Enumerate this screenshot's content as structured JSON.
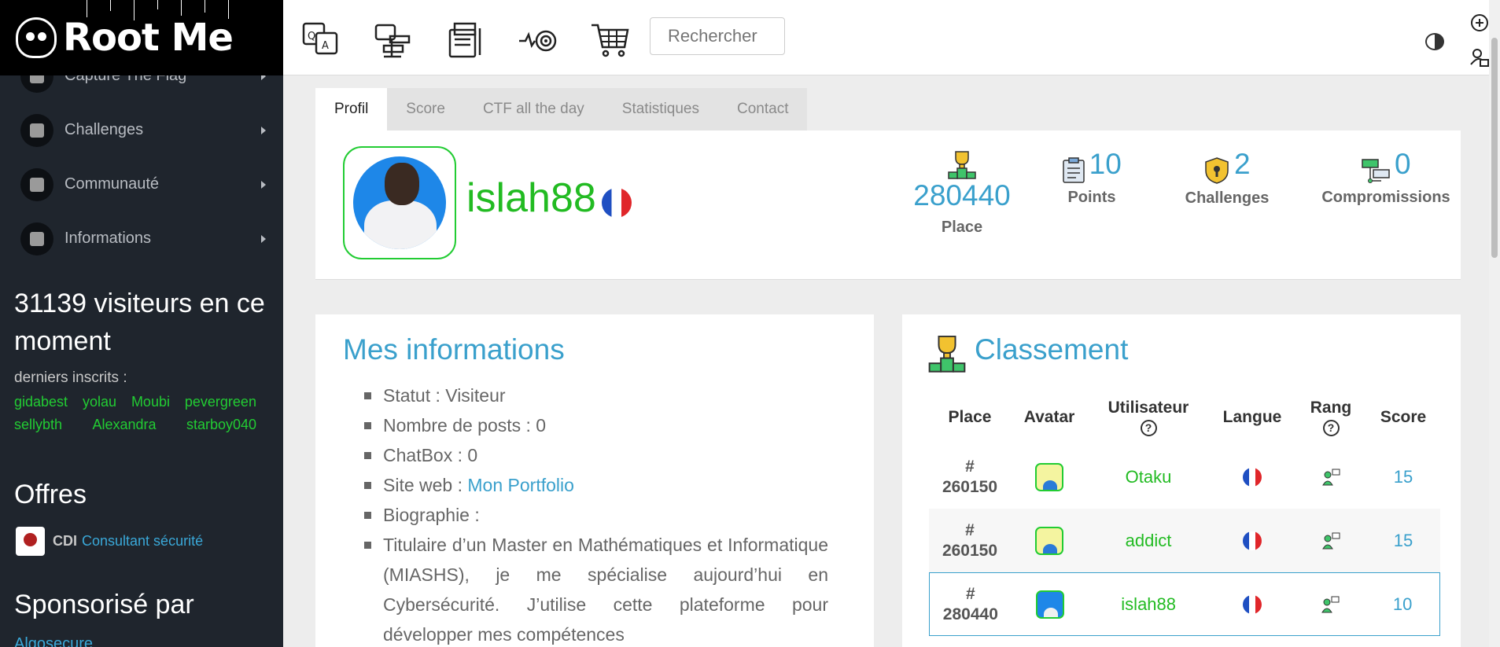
{
  "logo": {
    "text": "Root Me"
  },
  "sidebar": {
    "items": [
      {
        "label": "Capture The Flag"
      },
      {
        "label": "Challenges"
      },
      {
        "label": "Communauté"
      },
      {
        "label": "Informations"
      }
    ],
    "visitors": "31139 visiteurs en ce moment",
    "last_title": "derniers inscrits :",
    "last_users": [
      "gidabest",
      "yolau",
      "Moubi",
      "pevergreen",
      "sellybth",
      "Alexandra",
      "starboy040"
    ],
    "offres_title": "Offres",
    "offre": {
      "type": "CDI",
      "label": "Consultant sécurité"
    },
    "sponso_title": "Sponsorisé par",
    "sponso_link": "Algosecure"
  },
  "topbar": {
    "search_placeholder": "Rechercher"
  },
  "tabs": [
    "Profil",
    "Score",
    "CTF all the day",
    "Statistiques",
    "Contact"
  ],
  "profile": {
    "username": "islah88",
    "place": {
      "value": "280440",
      "label": "Place"
    },
    "points": {
      "value": "10",
      "label": "Points"
    },
    "challenges": {
      "value": "2",
      "label": "Challenges"
    },
    "compromissions": {
      "value": "0",
      "label": "Compromissions"
    }
  },
  "info": {
    "title": "Mes informations",
    "statut": "Statut : Visiteur",
    "posts": "Nombre de posts : 0",
    "chatbox": "ChatBox : 0",
    "site_prefix": "Site web : ",
    "site_link": "Mon Portfolio",
    "bio_label": "Biographie :",
    "bio_text": "Titulaire d’un Master en Mathématiques et Informatique (MIASHS), je me spécialise aujourd’hui en Cybersécurité. J’utilise cette plateforme pour développer mes compétences"
  },
  "ranking": {
    "title": "Classement",
    "headers": {
      "place": "Place",
      "avatar": "Avatar",
      "user": "Utilisateur",
      "lang": "Langue",
      "rang": "Rang",
      "score": "Score"
    },
    "rows": [
      {
        "hash": "#",
        "place": "260150",
        "user": "Otaku",
        "score": "15"
      },
      {
        "hash": "#",
        "place": "260150",
        "user": "addict",
        "score": "15"
      },
      {
        "hash": "#",
        "place": "280440",
        "user": "islah88",
        "score": "10"
      }
    ]
  }
}
